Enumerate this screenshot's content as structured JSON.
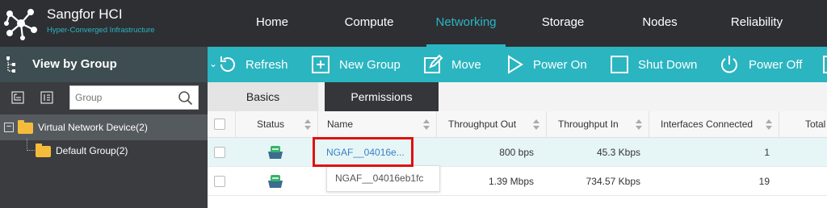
{
  "app": {
    "title": "Sangfor HCI",
    "tagline": "Hyper-Converged Infrastructure"
  },
  "nav": {
    "items": [
      {
        "label": "Home",
        "active": false
      },
      {
        "label": "Compute",
        "active": false
      },
      {
        "label": "Networking",
        "active": true
      },
      {
        "label": "Storage",
        "active": false
      },
      {
        "label": "Nodes",
        "active": false
      },
      {
        "label": "Reliability",
        "active": false
      }
    ]
  },
  "sidebar": {
    "header": "View by Group",
    "search_placeholder": "Group",
    "tree": [
      {
        "label": "Virtual Network Device(2)",
        "expanded": true,
        "selected": true
      },
      {
        "label": "Default Group(2)"
      }
    ]
  },
  "toolbar": {
    "items": [
      {
        "label": "Refresh",
        "icon": "refresh-icon"
      },
      {
        "label": "New Group",
        "icon": "new-group-icon"
      },
      {
        "label": "Move",
        "icon": "edit-icon"
      },
      {
        "label": "Power On",
        "icon": "play-icon"
      },
      {
        "label": "Shut Down",
        "icon": "stop-icon"
      },
      {
        "label": "Power Off",
        "icon": "power-icon"
      }
    ]
  },
  "tabs": [
    {
      "label": "Basics",
      "active": true
    },
    {
      "label": "Permissions",
      "active": false
    }
  ],
  "table": {
    "columns": [
      "Status",
      "Name",
      "Throughput Out",
      "Throughput In",
      "Interfaces Connected",
      "Total"
    ],
    "rows": [
      {
        "name": "NGAF__04016e...",
        "out": "800 bps",
        "in": "45.3 Kbps",
        "ifaces": "1"
      },
      {
        "name": "",
        "out": "1.39 Mbps",
        "in": "734.57 Kbps",
        "ifaces": "19"
      }
    ]
  },
  "tooltip": "NGAF__04016eb1fc",
  "colors": {
    "accent": "#2bb5c1",
    "topbar": "#2e2f33",
    "sidebar": "#3b3c40",
    "highlight": "#e01010",
    "link": "#3b7fc4"
  }
}
